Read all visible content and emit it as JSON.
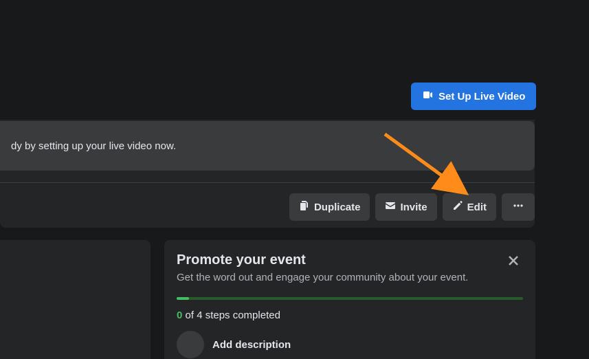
{
  "live_button": {
    "label": "Set Up Live Video"
  },
  "banner": {
    "text_fragment": "dy by setting up your live video now."
  },
  "actions": {
    "duplicate": "Duplicate",
    "invite": "Invite",
    "edit": "Edit"
  },
  "promote": {
    "title": "Promote your event",
    "subtitle": "Get the word out and engage your community about your event.",
    "steps_done": "0",
    "steps_rest": " of 4 steps completed",
    "first_step": "Add description"
  },
  "annotation": {
    "arrow_target": "edit-button"
  }
}
